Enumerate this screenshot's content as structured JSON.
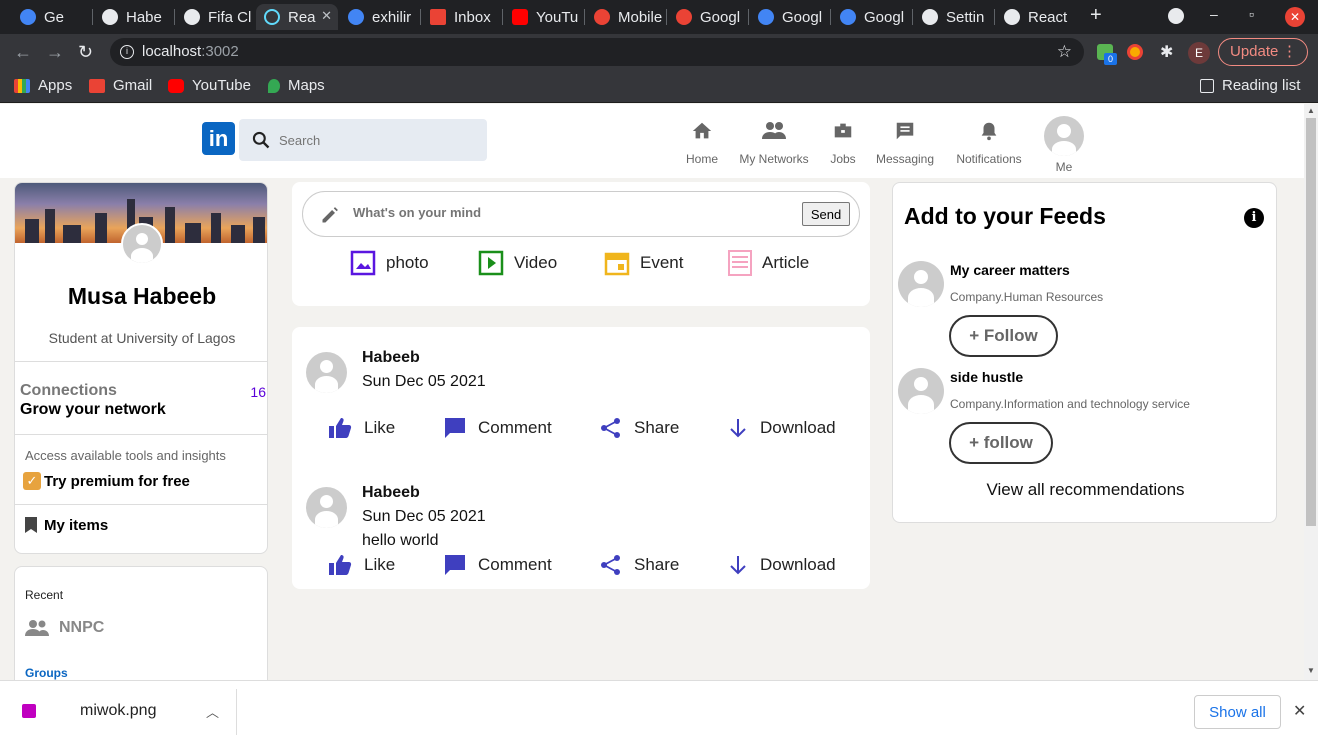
{
  "browser": {
    "tabs": [
      {
        "title": "Ge",
        "color": "#4285f4"
      },
      {
        "title": "Habe",
        "color": "#e8eaed"
      },
      {
        "title": "Fifa Cl",
        "color": "#e8eaed"
      },
      {
        "title": "Rea",
        "color": "#61dafb"
      },
      {
        "title": "exhilir",
        "color": "#4285f4"
      },
      {
        "title": "Inbox",
        "color": "#ea4335"
      },
      {
        "title": "YouTu",
        "color": "#ff0000"
      },
      {
        "title": "Mobile",
        "color": "#ea4335"
      },
      {
        "title": "Googl",
        "color": "#ea4335"
      },
      {
        "title": "Googl",
        "color": "#4285f4"
      },
      {
        "title": "Googl",
        "color": "#4285f4"
      },
      {
        "title": "Settin",
        "color": "#e8eaed"
      },
      {
        "title": "React",
        "color": "#e8eaed"
      }
    ],
    "url_host": "localhost",
    "url_port": ":3002",
    "bookmarks": [
      "Apps",
      "Gmail",
      "YouTube",
      "Maps"
    ],
    "reading_list": "Reading list",
    "update_label": "Update",
    "profile_initial": "E",
    "extension_badge": "0"
  },
  "header": {
    "logo": "in",
    "search_placeholder": "Search",
    "nav": [
      "Home",
      "My Networks",
      "Jobs",
      "Messaging",
      "Notifications",
      "Me"
    ]
  },
  "profile": {
    "name": "Musa Habeeb",
    "headline": "Student at University of Lagos",
    "connections_label": "Connections",
    "connections_count": "16",
    "grow": "Grow your network",
    "access": "Access available tools and insights",
    "premium": "Try premium for free",
    "my_items": "My items"
  },
  "recent": {
    "label": "Recent",
    "item": "NNPC",
    "groups": "Groups"
  },
  "share": {
    "placeholder": "What's on your mind",
    "send": "Send",
    "options": [
      "photo",
      "Video",
      "Event",
      "Article"
    ]
  },
  "posts": [
    {
      "author": "Habeeb",
      "date": "Sun Dec 05 2021",
      "text": ""
    },
    {
      "author": "Habeeb",
      "date": "Sun Dec 05 2021",
      "text": "hello world"
    }
  ],
  "actions": [
    "Like",
    "Comment",
    "Share",
    "Download"
  ],
  "feeds": {
    "title": "Add to your Feeds",
    "items": [
      {
        "name": "My career matters",
        "desc": "Company.Human Resources",
        "button": "+ Follow"
      },
      {
        "name": "side hustle",
        "desc": "Company.Information and technology service",
        "button": "+ follow"
      }
    ],
    "view_all": "View all recommendations"
  },
  "download_bar": {
    "file": "miwok.png",
    "show_all": "Show all"
  },
  "colors": {
    "brand": "#0a66c2",
    "action_blue": "#3f3fbf",
    "premium": "#e7a33e"
  }
}
